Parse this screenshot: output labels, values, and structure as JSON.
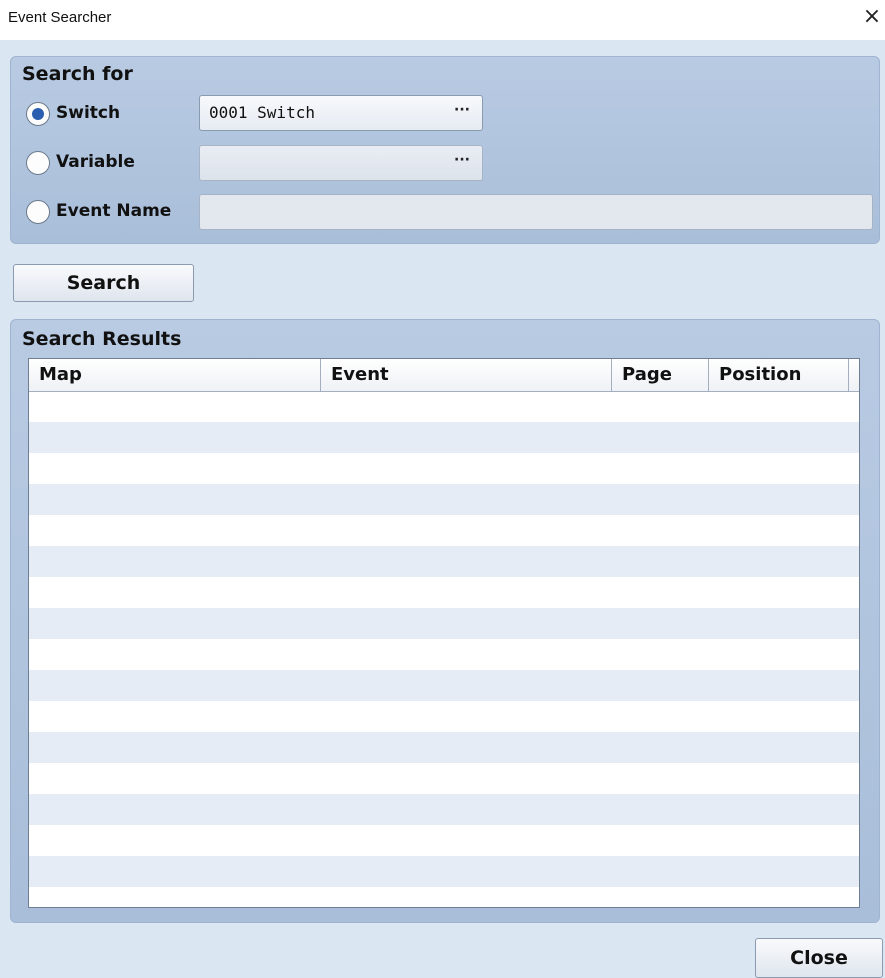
{
  "window": {
    "title": "Event Searcher",
    "close_glyph": "×"
  },
  "search_for": {
    "label": "Search for",
    "switch": {
      "label": "Switch",
      "checked": true,
      "value": "0001 Switch",
      "button_glyph": "···"
    },
    "variable": {
      "label": "Variable",
      "checked": false,
      "value": "",
      "button_glyph": "···"
    },
    "event_name": {
      "label": "Event Name",
      "checked": false,
      "value": ""
    }
  },
  "search_button": {
    "label": "Search"
  },
  "results": {
    "label": "Search Results",
    "columns": [
      "Map",
      "Event",
      "Page",
      "Position"
    ],
    "rows": []
  },
  "close_button": {
    "label": "Close"
  },
  "colors": {
    "panel": "#b9cbe3",
    "background": "#dbe6f3",
    "row_stripe": "#e5ecf6",
    "radio_accent": "#2a5fb0"
  }
}
